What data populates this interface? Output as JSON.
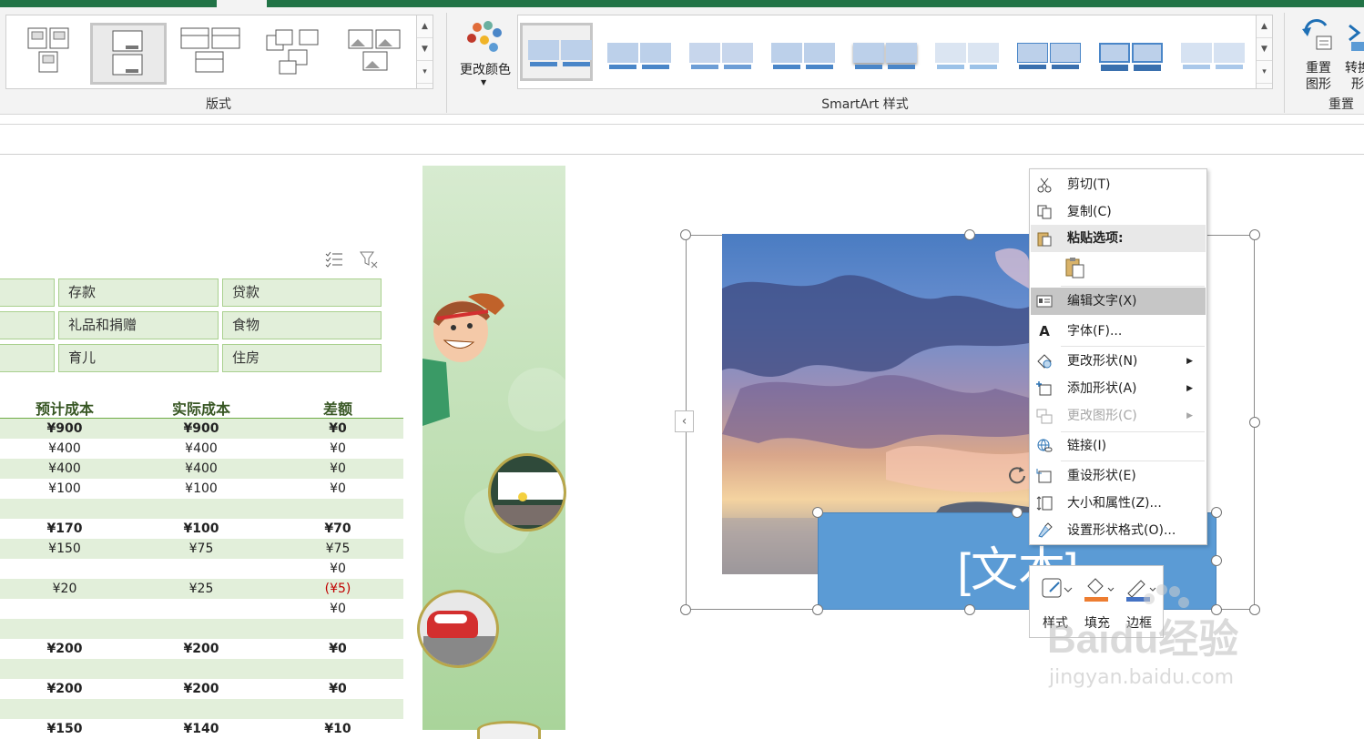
{
  "ribbon": {
    "layouts_group_label": "版式",
    "change_colors_label": "更改颜色",
    "smartart_styles_group_label": "SmartArt 样式",
    "reset_graphic_label_line1": "重置",
    "reset_graphic_label_line2": "图形",
    "convert_label_line1": "转换",
    "convert_label_line2": "形",
    "reset_group_label": "重置"
  },
  "slicers": {
    "row1": [
      "存款",
      "贷款"
    ],
    "row2": [
      "礼品和捐赠",
      "食物"
    ],
    "row3": [
      "育儿",
      "住房"
    ]
  },
  "table": {
    "headers": [
      "预计成本",
      "实际成本",
      "差额"
    ],
    "rows": [
      {
        "cells": [
          "¥900",
          "¥900",
          "¥0"
        ],
        "bold": true
      },
      {
        "cells": [
          "¥400",
          "¥400",
          "¥0"
        ],
        "bold": false
      },
      {
        "cells": [
          "¥400",
          "¥400",
          "¥0"
        ],
        "bold": false
      },
      {
        "cells": [
          "¥100",
          "¥100",
          "¥0"
        ],
        "bold": false
      },
      {
        "cells": [
          "",
          "",
          ""
        ],
        "bold": false
      },
      {
        "cells": [
          "¥170",
          "¥100",
          "¥70"
        ],
        "bold": true
      },
      {
        "cells": [
          "¥150",
          "¥75",
          "¥75"
        ],
        "bold": false
      },
      {
        "cells": [
          "",
          "",
          "¥0"
        ],
        "bold": false
      },
      {
        "cells": [
          "¥20",
          "¥25",
          "(¥5)"
        ],
        "bold": false,
        "negative": true
      },
      {
        "cells": [
          "",
          "",
          "¥0"
        ],
        "bold": false
      },
      {
        "cells": [
          "",
          "",
          ""
        ],
        "bold": false
      },
      {
        "cells": [
          "¥200",
          "¥200",
          "¥0"
        ],
        "bold": true
      },
      {
        "cells": [
          "",
          "",
          ""
        ],
        "bold": false
      },
      {
        "cells": [
          "¥200",
          "¥200",
          "¥0"
        ],
        "bold": true
      },
      {
        "cells": [
          "",
          "",
          ""
        ],
        "bold": false
      },
      {
        "cells": [
          "¥150",
          "¥140",
          "¥10"
        ],
        "bold": true
      }
    ]
  },
  "smartart": {
    "text_placeholder": "[文本]"
  },
  "context_menu": {
    "items": [
      {
        "label": "剪切(T)",
        "icon": "scissors-icon"
      },
      {
        "label": "复制(C)",
        "icon": "copy-icon"
      },
      {
        "label": "粘贴选项:",
        "icon": "paste-icon"
      },
      {
        "label": "编辑文字(X)",
        "icon": "edit-text-icon"
      },
      {
        "label": "字体(F)...",
        "icon": "font-icon"
      },
      {
        "label": "更改形状(N)",
        "icon": "change-shape-icon"
      },
      {
        "label": "添加形状(A)",
        "icon": "add-shape-icon"
      },
      {
        "label": "更改图形(C)",
        "icon": "change-graphic-icon"
      },
      {
        "label": "链接(I)",
        "icon": "link-icon"
      },
      {
        "label": "重设形状(E)",
        "icon": "reset-shape-icon"
      },
      {
        "label": "大小和属性(Z)...",
        "icon": "size-properties-icon"
      },
      {
        "label": "设置形状格式(O)...",
        "icon": "format-shape-icon"
      }
    ]
  },
  "mini_toolbar": {
    "style_label": "样式",
    "fill_label": "填充",
    "border_label": "边框"
  },
  "watermark": {
    "brand": "Baidu经验",
    "url": "jingyan.baidu.com"
  },
  "colors": {
    "excel_green": "#217346",
    "accent_blue": "#5b9bd5",
    "slicer_fill": "#e2efda",
    "header_text": "#375623",
    "negative": "#c00000"
  }
}
